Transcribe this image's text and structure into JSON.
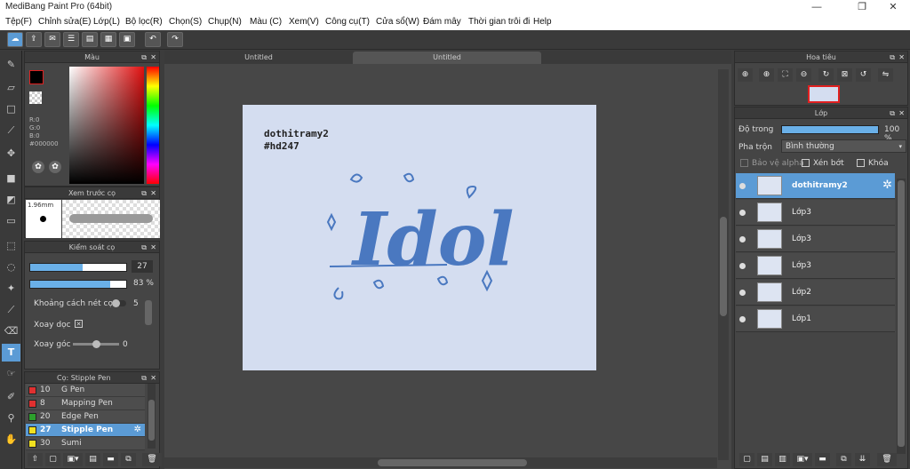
{
  "window": {
    "title": "MediBang Paint Pro (64bit)",
    "minimize": "—",
    "maximize": "❐",
    "close": "✕"
  },
  "menu": [
    "Tệp(F)",
    "Chỉnh sửa(E)",
    "Lớp(L)",
    "Bộ lọc(R)",
    "Chọn(S)",
    "Chụp(N)",
    "Màu (C)",
    "Xem(V)",
    "Công cụ(T)",
    "Cửa sổ(W)",
    "Đám mây",
    "Thời gian trôi đi",
    "Help"
  ],
  "tabs": [
    "Untitled",
    "Untitled"
  ],
  "color_panel": {
    "title": "Màu",
    "r": "R:0",
    "g": "G:0",
    "b": "B:0",
    "hex": "#000000"
  },
  "brush_preview": {
    "title": "Xem trước cọ",
    "size": "1.96mm"
  },
  "brush_control": {
    "title": "Kiểm soát cọ",
    "size_value": "27",
    "size_fill": 0.55,
    "opacity_value": "83 %",
    "opacity_fill": 0.83,
    "spacing_label": "Khoảng cách nét cọ",
    "spacing_value": "5",
    "flip_label": "Xoay dọc",
    "rotate_label": "Xoay góc",
    "rotate_value": "0"
  },
  "brush_list": {
    "title": "Cọ: Stipple Pen",
    "items": [
      {
        "num": "10",
        "name": "G Pen",
        "color": "#e03030"
      },
      {
        "num": "8",
        "name": "Mapping Pen",
        "color": "#e03030"
      },
      {
        "num": "20",
        "name": "Edge Pen",
        "color": "#2ca02c"
      },
      {
        "num": "27",
        "name": "Stipple Pen",
        "color": "#f0e020"
      },
      {
        "num": "30",
        "name": "Sumi",
        "color": "#f0e020"
      }
    ]
  },
  "canvas": {
    "text1": "dothitramy2",
    "text2": "#hd247",
    "lettering": "Idol"
  },
  "navigator": {
    "title": "Hoa tiêu"
  },
  "layer_panel": {
    "title": "Lớp",
    "opacity_label": "Độ trong",
    "opacity_value": "100 %",
    "blend_label": "Pha trộn",
    "blend_value": "Bình thường",
    "protect_alpha": "Bảo vệ alpha",
    "clip": "Xén bớt",
    "lock": "Khóa"
  },
  "layers": [
    {
      "name": "dothitramy2",
      "selected": true
    },
    {
      "name": "Lớp3",
      "selected": false
    },
    {
      "name": "Lớp3",
      "selected": false
    },
    {
      "name": "Lớp3",
      "selected": false
    },
    {
      "name": "Lớp2",
      "selected": false
    },
    {
      "name": "Lớp1",
      "selected": false
    }
  ],
  "colors": {
    "accent": "#5b9bd5",
    "canvas": "#d4ddf0",
    "lettering": "#4a78c0"
  }
}
